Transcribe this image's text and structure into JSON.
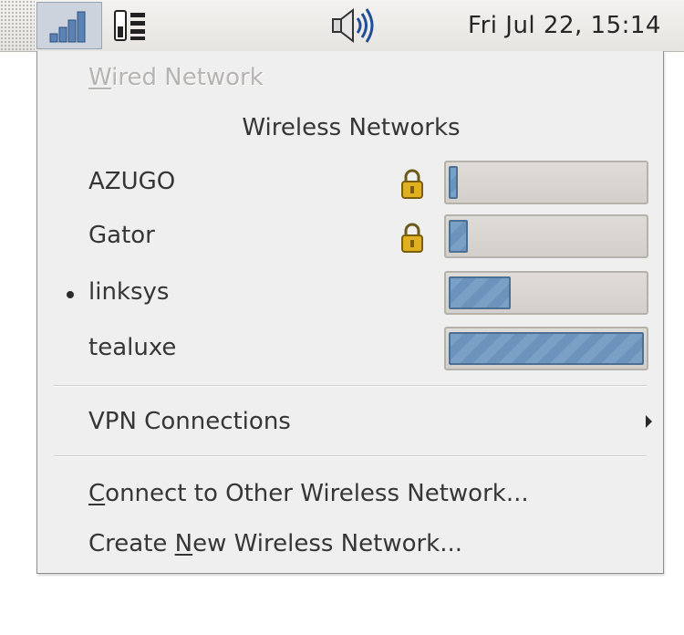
{
  "panel": {
    "clock": "Fri Jul 22, 15:14",
    "icons": [
      "network-signal-icon",
      "system-monitor-icon",
      "volume-icon"
    ]
  },
  "menu": {
    "wired": {
      "label_u": "W",
      "label_rest": "ired Network",
      "enabled": false
    },
    "wireless_heading": "Wireless Networks",
    "networks": [
      {
        "name": "AZUGO",
        "secured": true,
        "connected": false,
        "signal": 0.03
      },
      {
        "name": "Gator",
        "secured": true,
        "connected": false,
        "signal": 0.1
      },
      {
        "name": "linksys",
        "secured": false,
        "connected": true,
        "signal": 0.32
      },
      {
        "name": "tealuxe",
        "secured": false,
        "connected": false,
        "signal": 1.0
      }
    ],
    "vpn": {
      "label": "VPN Connections",
      "has_submenu": true
    },
    "connect_other": {
      "label_u": "C",
      "label_rest": "onnect to Other Wireless Network..."
    },
    "create_new": {
      "label_pre": "Create ",
      "label_u": "N",
      "label_rest": "ew Wireless Network..."
    }
  },
  "colors": {
    "menu_bg": "#efefef",
    "signal_fill": "#7aa0c6",
    "signal_border": "#4d6f93",
    "lock": "#d9a514"
  }
}
